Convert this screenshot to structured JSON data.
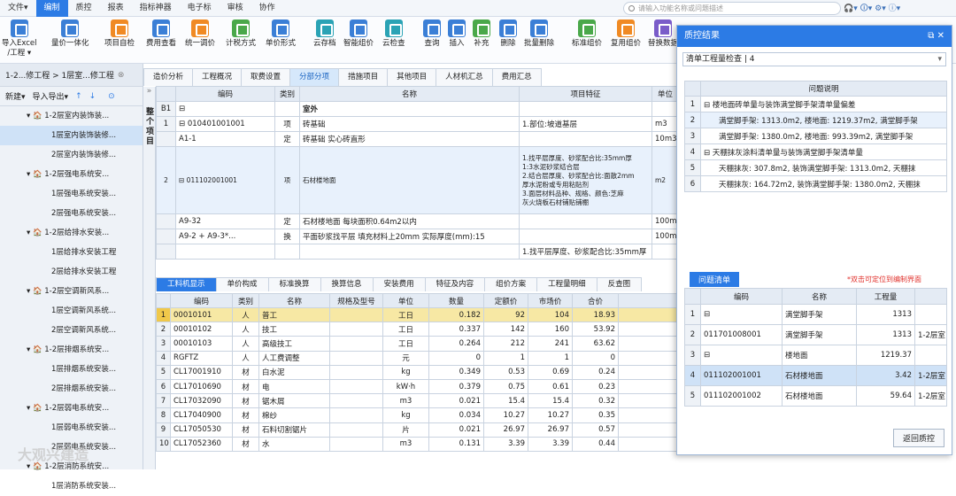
{
  "menu": {
    "items": [
      "文件▾",
      "编制",
      "质控",
      "报表",
      "指标神器",
      "电子标",
      "审核",
      "协作"
    ],
    "active_index": 1,
    "search_placeholder": "请输入功能名称或问题描述",
    "top_icons": "🎧▾ 🛈▾ ⚙▾ ⓘ▾"
  },
  "ribbon": [
    {
      "label": "导入Excel\n/工程 ▾",
      "icon": "import-icon",
      "color": "blue"
    },
    {
      "label": "量价一体化",
      "icon": "chart-icon",
      "color": "blue"
    },
    {
      "label": "项目自检",
      "icon": "check-icon",
      "color": "orange"
    },
    {
      "label": "费用查看",
      "icon": "view-icon",
      "color": "blue"
    },
    {
      "label": "统一调价",
      "icon": "price-icon",
      "color": "orange"
    },
    {
      "label": "计税方式",
      "icon": "tax-icon",
      "color": "green"
    },
    {
      "label": "单价形式",
      "icon": "form-icon",
      "color": "blue"
    },
    {
      "label": "云存档",
      "icon": "cloud-save-icon",
      "color": "teal"
    },
    {
      "label": "智能组价",
      "icon": "smart-icon",
      "color": "blue"
    },
    {
      "label": "云检查",
      "icon": "cloud-check-icon",
      "color": "teal"
    },
    {
      "label": "查询",
      "icon": "query-icon",
      "color": "blue"
    },
    {
      "label": "插入",
      "icon": "insert-icon",
      "color": "blue"
    },
    {
      "label": "补充",
      "icon": "supplement-icon",
      "color": "green"
    },
    {
      "label": "删除",
      "icon": "delete-icon",
      "color": "blue"
    },
    {
      "label": "批量删除",
      "icon": "batch-delete-icon",
      "color": "blue"
    },
    {
      "label": "标准组价",
      "icon": "standard-icon",
      "color": "green"
    },
    {
      "label": "复用组价",
      "icon": "reuse-icon",
      "color": "orange"
    },
    {
      "label": "替换数据",
      "icon": "replace-icon",
      "color": "purple"
    }
  ],
  "left": {
    "breadcrumb": "1-2...修工程 > 1层室...修工程",
    "new_label": "新建▾",
    "import_label": "导入导出▾",
    "items": [
      {
        "label": "▾ 🏠 1-2层室内装饰装...",
        "indent": 30
      },
      {
        "label": "1层室内装饰装修...",
        "indent": 58,
        "selected": true
      },
      {
        "label": "2层室内装饰装修...",
        "indent": 58
      },
      {
        "label": "▾ 🏠 1-2层强电系统安...",
        "indent": 30
      },
      {
        "label": "1层强电系统安装...",
        "indent": 58
      },
      {
        "label": "2层强电系统安装...",
        "indent": 58
      },
      {
        "label": "▾ 🏠 1-2层给排水安装...",
        "indent": 30
      },
      {
        "label": "1层给排水安装工程",
        "indent": 58
      },
      {
        "label": "2层给排水安装工程",
        "indent": 58
      },
      {
        "label": "▾ 🏠 1-2层空调新风系...",
        "indent": 30
      },
      {
        "label": "1层空调新风系统...",
        "indent": 58
      },
      {
        "label": "2层空调新风系统...",
        "indent": 58
      },
      {
        "label": "▾ 🏠 1-2层排烟系统安...",
        "indent": 30
      },
      {
        "label": "1层排烟系统安装...",
        "indent": 58
      },
      {
        "label": "2层排烟系统安装...",
        "indent": 58
      },
      {
        "label": "▾ 🏠 1-2层弱电系统安...",
        "indent": 30
      },
      {
        "label": "1层弱电系统安装...",
        "indent": 58
      },
      {
        "label": "2层弱电系统安装...",
        "indent": 58
      },
      {
        "label": "▾ 🏠 1-2层消防系统安...",
        "indent": 30
      },
      {
        "label": "1层消防系统安装...",
        "indent": 58
      }
    ]
  },
  "tabs": [
    "造价分析",
    "工程概况",
    "取费设置",
    "分部分项",
    "措施项目",
    "其他项目",
    "人材机汇总",
    "费用汇总"
  ],
  "active_tab": 3,
  "vertical_label": "整个项目",
  "grid1": {
    "headers": [
      "",
      "编码",
      "类别",
      "名称",
      "项目特征",
      "单位"
    ],
    "rows": [
      {
        "no": "B1",
        "code": "⊟",
        "type": "",
        "name": "室外",
        "feature": "",
        "unit": ""
      },
      {
        "no": "1",
        "code": "⊟ 010401001001",
        "type": "项",
        "name": "砖基础",
        "feature": "1.部位:坡道基层",
        "unit": "m3"
      },
      {
        "no": "",
        "code": "A1-1",
        "type": "定",
        "name": "砖基础 实心砖直形",
        "feature": "",
        "unit": "10m3"
      },
      {
        "no": "2",
        "code": "⊟ 011102001001",
        "type": "项",
        "name": "石材楼地面",
        "feature": "1.找平层厚度、砂浆配合比:35mm厚\n1:3水泥砂浆结合层\n2.结合层厚度、砂浆配合比:面散2mm\n厚水泥粉或专用粘贴剂\n3.面层材料品种、规格、颜色:芝麻\n灰火烧板石材铺贴铺棚",
        "unit": "m2"
      },
      {
        "no": "",
        "code": "A9-32",
        "type": "定",
        "name": "石材楼地面 每块面积0.64m2以内",
        "feature": "",
        "unit": "100m2"
      },
      {
        "no": "",
        "code": "A9-2 + A9-3*...",
        "type": "换",
        "name": "平面砂浆找平层 填充材料上20mm  实际厚度(mm):15",
        "feature": "",
        "unit": "100m2"
      },
      {
        "no": "",
        "code": "",
        "type": "",
        "name": "",
        "feature": "1.找平层厚度、砂浆配合比:35mm厚",
        "unit": ""
      }
    ]
  },
  "bottom_tabs": [
    "工料机显示",
    "单价构成",
    "标准换算",
    "换算信息",
    "安装费用",
    "特征及内容",
    "组价方案",
    "工程量明细",
    "反查图"
  ],
  "grid2": {
    "headers": [
      "",
      "编码",
      "类别",
      "名称",
      "规格及型号",
      "单位",
      "数量",
      "定额价",
      "市场价",
      "合价"
    ],
    "rows": [
      [
        "1",
        "00010101",
        "人",
        "普工",
        "",
        "工日",
        "0.182",
        "92",
        "104",
        "18.93"
      ],
      [
        "2",
        "00010102",
        "人",
        "技工",
        "",
        "工日",
        "0.337",
        "142",
        "160",
        "53.92"
      ],
      [
        "3",
        "00010103",
        "人",
        "高级技工",
        "",
        "工日",
        "0.264",
        "212",
        "241",
        "63.62"
      ],
      [
        "4",
        "RGFTZ",
        "人",
        "人工费调整",
        "",
        "元",
        "0",
        "1",
        "1",
        "0"
      ],
      [
        "5",
        "CL17001910",
        "材",
        "白水泥",
        "",
        "kg",
        "0.349",
        "0.53",
        "0.69",
        "0.24"
      ],
      [
        "6",
        "CL17010690",
        "材",
        "电",
        "",
        "kW·h",
        "0.379",
        "0.75",
        "0.61",
        "0.23"
      ],
      [
        "7",
        "CL17032090",
        "材",
        "锯木屑",
        "",
        "m3",
        "0.021",
        "15.4",
        "15.4",
        "0.32"
      ],
      [
        "8",
        "CL17040900",
        "材",
        "棉纱",
        "",
        "kg",
        "0.034",
        "10.27",
        "10.27",
        "0.35"
      ],
      [
        "9",
        "CL17050530",
        "材",
        "石料切割锯片",
        "",
        "片",
        "0.021",
        "26.97",
        "26.97",
        "0.57"
      ],
      [
        "10",
        "CL17052360",
        "材",
        "水",
        "",
        "m3",
        "0.131",
        "3.39",
        "3.39",
        "0.44"
      ]
    ]
  },
  "panel": {
    "title": "质控结果",
    "title_controls": "⧉ ✕",
    "select_value": "清单工程量检查 | 4",
    "header": "问题说明",
    "rows": [
      {
        "no": "1",
        "text": "⊟ 楼地面砖单量与装饰满堂脚手架清单量偏差"
      },
      {
        "no": "2",
        "text": "满堂脚手架: 1313.0m2, 楼地面: 1219.37m2, 满堂脚手架",
        "selected": true
      },
      {
        "no": "3",
        "text": "满堂脚手架: 1380.0m2, 楼地面: 993.39m2, 满堂脚手架"
      },
      {
        "no": "4",
        "text": "⊟ 天棚抹灰涂料清单量与装饰满堂脚手架清单量"
      },
      {
        "no": "5",
        "text": "天棚抹灰: 307.8m2, 装饰满堂脚手架: 1313.0m2, 天棚抹"
      },
      {
        "no": "6",
        "text": "天棚抹灰: 164.72m2, 装饰满堂脚手架: 1380.0m2, 天棚抹"
      }
    ],
    "tab_label": "问题清单",
    "hint": "*双击可定位到编制界面",
    "grid2_headers": [
      "",
      "编码",
      "名称",
      "工程量",
      ""
    ],
    "grid2_rows": [
      {
        "no": "1",
        "code": "⊟",
        "name": "满堂脚手架",
        "qty": "1313",
        "extra": ""
      },
      {
        "no": "2",
        "code": "011701008001",
        "name": "满堂脚手架",
        "qty": "1313",
        "extra": "1-2层室"
      },
      {
        "no": "3",
        "code": "⊟",
        "name": "楼地面",
        "qty": "1219.37",
        "extra": ""
      },
      {
        "no": "4",
        "code": "011102001001",
        "name": "石材楼地面",
        "qty": "3.42",
        "extra": "1-2层室",
        "selected": true
      },
      {
        "no": "5",
        "code": "011102001002",
        "name": "石材楼地面",
        "qty": "59.64",
        "extra": "1-2层室"
      }
    ],
    "back_button": "返回质控"
  },
  "watermark": "大观兴建造"
}
